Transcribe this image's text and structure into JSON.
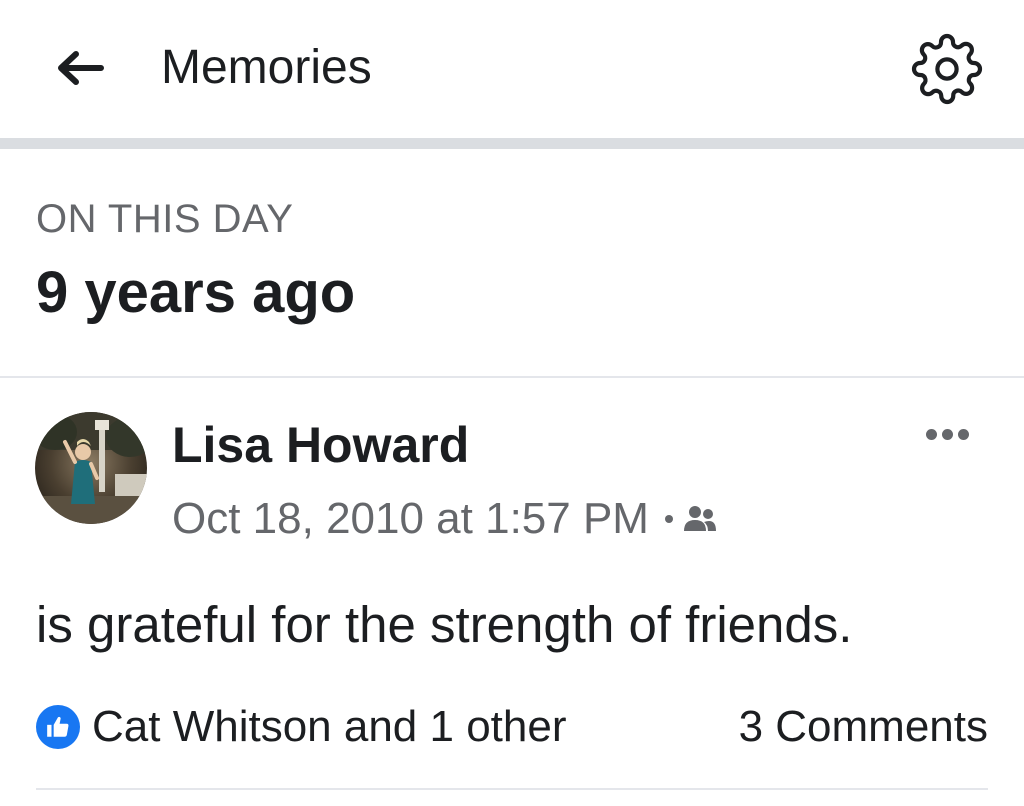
{
  "header": {
    "back_icon": "arrow-left-icon",
    "title": "Memories",
    "settings_icon": "gear-icon"
  },
  "section": {
    "label": "ON THIS DAY",
    "title": "9 years ago"
  },
  "post": {
    "author": "Lisa Howard",
    "timestamp": "Oct 18, 2010 at 1:57 PM",
    "audience_icon": "friends-icon",
    "more_icon": "more-options-icon",
    "text": "is grateful for the strength of friends.",
    "reactions": {
      "icon": "like-icon",
      "text": "Cat Whitson and 1 other"
    },
    "comments": "3 Comments"
  },
  "colors": {
    "accent": "#1877f2",
    "secondary_text": "#65676b",
    "primary_text": "#1c1e21",
    "divider": "#dadde1"
  }
}
